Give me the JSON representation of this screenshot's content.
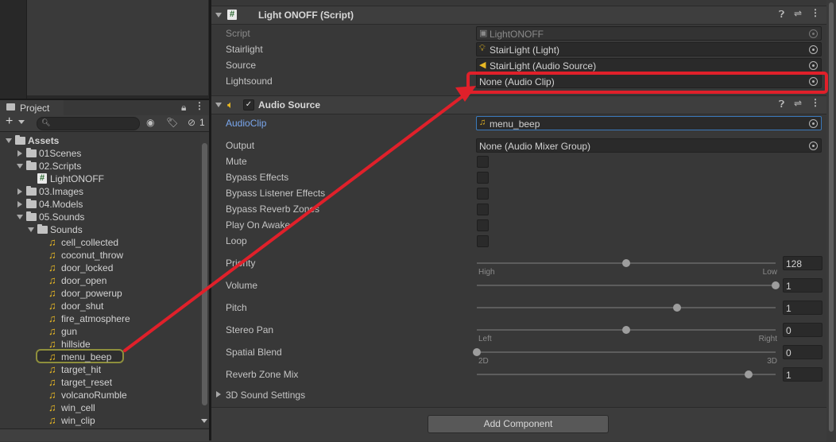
{
  "project_panel": {
    "tab_label": "Project",
    "hidden_count": "1",
    "tree": [
      {
        "label": "Assets",
        "depth": 0,
        "kind": "folder",
        "expanded": true,
        "bold": true
      },
      {
        "label": "01Scenes",
        "depth": 1,
        "kind": "folder",
        "expanded": false
      },
      {
        "label": "02.Scripts",
        "depth": 1,
        "kind": "folder",
        "expanded": true
      },
      {
        "label": "LightONOFF",
        "depth": 2,
        "kind": "script"
      },
      {
        "label": "03.Images",
        "depth": 1,
        "kind": "folder",
        "expanded": false
      },
      {
        "label": "04.Models",
        "depth": 1,
        "kind": "folder",
        "expanded": false
      },
      {
        "label": "05.Sounds",
        "depth": 1,
        "kind": "folder",
        "expanded": true
      },
      {
        "label": "Sounds",
        "depth": 2,
        "kind": "folder",
        "expanded": true
      },
      {
        "label": "cell_collected",
        "depth": 3,
        "kind": "audio"
      },
      {
        "label": "coconut_throw",
        "depth": 3,
        "kind": "audio"
      },
      {
        "label": "door_locked",
        "depth": 3,
        "kind": "audio"
      },
      {
        "label": "door_open",
        "depth": 3,
        "kind": "audio"
      },
      {
        "label": "door_powerup",
        "depth": 3,
        "kind": "audio"
      },
      {
        "label": "door_shut",
        "depth": 3,
        "kind": "audio"
      },
      {
        "label": "fire_atmosphere",
        "depth": 3,
        "kind": "audio"
      },
      {
        "label": "gun",
        "depth": 3,
        "kind": "audio"
      },
      {
        "label": "hillside",
        "depth": 3,
        "kind": "audio"
      },
      {
        "label": "menu_beep",
        "depth": 3,
        "kind": "audio",
        "highlighted": true
      },
      {
        "label": "target_hit",
        "depth": 3,
        "kind": "audio"
      },
      {
        "label": "target_reset",
        "depth": 3,
        "kind": "audio"
      },
      {
        "label": "volcanoRumble",
        "depth": 3,
        "kind": "audio"
      },
      {
        "label": "win_cell",
        "depth": 3,
        "kind": "audio"
      },
      {
        "label": "win_clip",
        "depth": 3,
        "kind": "audio"
      }
    ]
  },
  "light_script": {
    "title": "Light ONOFF (Script)",
    "rows": [
      {
        "label": "Script",
        "value": "LightONOFF",
        "icon": "script-icon",
        "disabled": true
      },
      {
        "label": "Stairlight",
        "value": "StairLight (Light)",
        "icon": "bulb-icon"
      },
      {
        "label": "Source",
        "value": "StairLight (Audio Source)",
        "icon": "speaker-icon"
      },
      {
        "label": "Lightsound",
        "value": "None (Audio Clip)",
        "icon": ""
      }
    ]
  },
  "audio_source": {
    "title": "Audio Source",
    "audioclip_label": "AudioClip",
    "audioclip_value": "menu_beep",
    "output_label": "Output",
    "output_value": "None (Audio Mixer Group)",
    "checkboxes": [
      "Mute",
      "Bypass Effects",
      "Bypass Listener Effects",
      "Bypass Reverb Zones",
      "Play On Awake",
      "Loop"
    ],
    "sliders": [
      {
        "label": "Priority",
        "value": "128",
        "level": 0.5,
        "min_label": "High",
        "max_label": "Low"
      },
      {
        "label": "Volume",
        "value": "1",
        "level": 1.0
      },
      {
        "label": "Pitch",
        "value": "1",
        "level": 0.67
      },
      {
        "label": "Stereo Pan",
        "value": "0",
        "level": 0.5,
        "min_label": "Left",
        "max_label": "Right"
      },
      {
        "label": "Spatial Blend",
        "value": "0",
        "level": 0.0,
        "min_label": "2D",
        "max_label": "3D"
      },
      {
        "label": "Reverb Zone Mix",
        "value": "1",
        "level": 0.91
      }
    ],
    "sound_settings_label": "3D Sound Settings"
  },
  "add_component_label": "Add Component",
  "colors": {
    "annotation": "#e0202a",
    "highlight_border": "#8e8f3c",
    "accent_blue": "#7aa7ee",
    "audio_icon": "#e8b824"
  }
}
